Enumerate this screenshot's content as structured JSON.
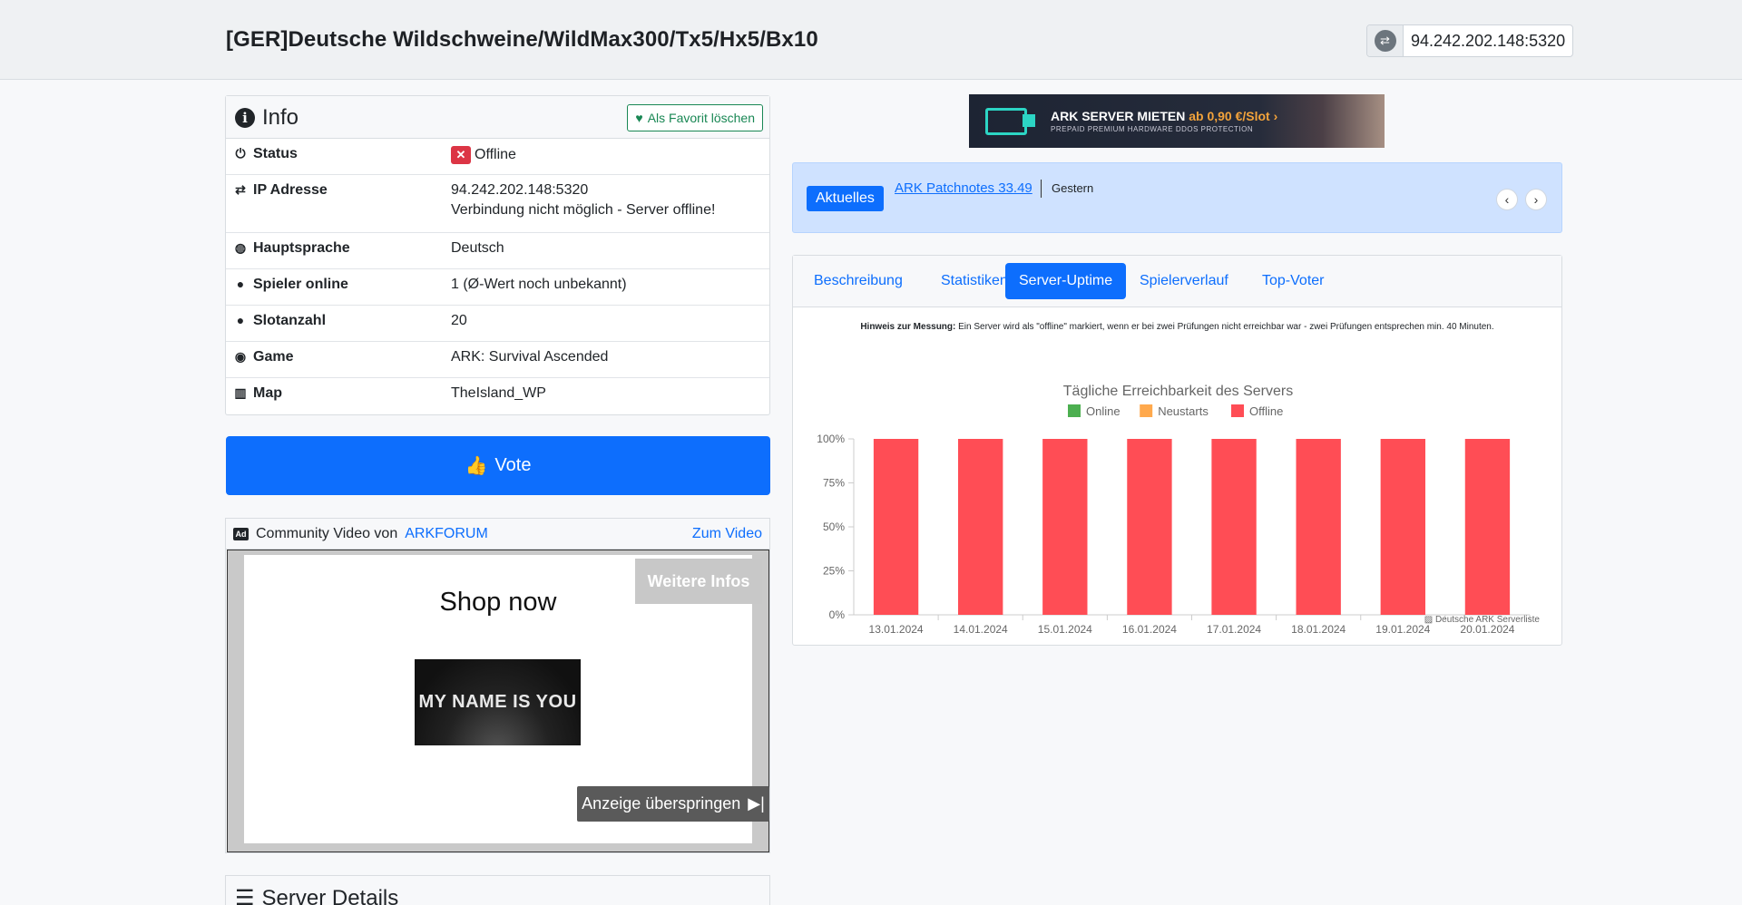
{
  "header": {
    "title": "[GER]Deutsche Wildschweine/WildMax300/Tx5/Hx5/Bx10",
    "ip": "94.242.202.148:5320"
  },
  "info": {
    "title": "Info",
    "fav_button": "Als Favorit löschen",
    "rows": [
      {
        "icon": "power-icon",
        "label": "Status",
        "value": "Offline"
      },
      {
        "icon": "shuffle-icon",
        "label": "IP Adresse",
        "value": "94.242.202.148:5320",
        "value2": "Verbindung nicht möglich - Server offline!"
      },
      {
        "icon": "globe-icon",
        "label": "Hauptsprache",
        "value": "Deutsch"
      },
      {
        "icon": "user-icon",
        "label": "Spieler online",
        "value": "1 (Ø-Wert noch unbekannt)"
      },
      {
        "icon": "user-icon",
        "label": "Slotanzahl",
        "value": "20"
      },
      {
        "icon": "gamepad-icon",
        "label": "Game",
        "value": "ARK: Survival Ascended"
      },
      {
        "icon": "map-icon",
        "label": "Map",
        "value": "TheIsland_WP"
      }
    ]
  },
  "vote_button": "Vote",
  "video": {
    "label": "Community Video von",
    "source": "ARKFORUM",
    "link": "Zum Video",
    "shop": "Shop now",
    "thumb_text": "MY NAME IS YOU",
    "more_info": "Weitere Infos",
    "skip": "Anzeige überspringen"
  },
  "details": {
    "title": "Server Details"
  },
  "banner": {
    "title": "ARK SERVER MIETEN",
    "price": "ab 0,90 €/Slot",
    "tagline": "PREPAID  PREMIUM HARDWARE  DDOS PROTECTION"
  },
  "news": {
    "badge": "Aktuelles",
    "link": "ARK Patchnotes 33.49",
    "date": "Gestern"
  },
  "tabs": [
    "Beschreibung",
    "Statistiken",
    "Server-Uptime",
    "Spielerverlauf",
    "Top-Voter"
  ],
  "hint": {
    "bold": "Hinweis zur Messung:",
    "text": " Ein Server wird als \"offline\" markiert, wenn er bei zwei Prüfungen nicht erreichbar war - zwei Prüfungen entsprechen min. 40 Minuten."
  },
  "credit": "Deutsche ARK Serverliste",
  "chart_data": {
    "type": "bar",
    "title": "Tägliche Erreichbarkeit des Servers",
    "categories": [
      "13.01.2024",
      "14.01.2024",
      "15.01.2024",
      "16.01.2024",
      "17.01.2024",
      "18.01.2024",
      "19.01.2024",
      "20.01.2024"
    ],
    "series": [
      {
        "name": "Online",
        "color": "#4caf50",
        "values": [
          0,
          0,
          0,
          0,
          0,
          0,
          0,
          0
        ]
      },
      {
        "name": "Neustarts",
        "color": "#ffa94d",
        "values": [
          0,
          0,
          0,
          0,
          0,
          0,
          0,
          0
        ]
      },
      {
        "name": "Offline",
        "color": "#ff4d55",
        "values": [
          100,
          100,
          100,
          100,
          100,
          100,
          100,
          100
        ]
      }
    ],
    "yticks": [
      "0%",
      "25%",
      "50%",
      "75%",
      "100%"
    ],
    "ylim": [
      0,
      100
    ],
    "legend": "top-center",
    "stacked": true
  }
}
